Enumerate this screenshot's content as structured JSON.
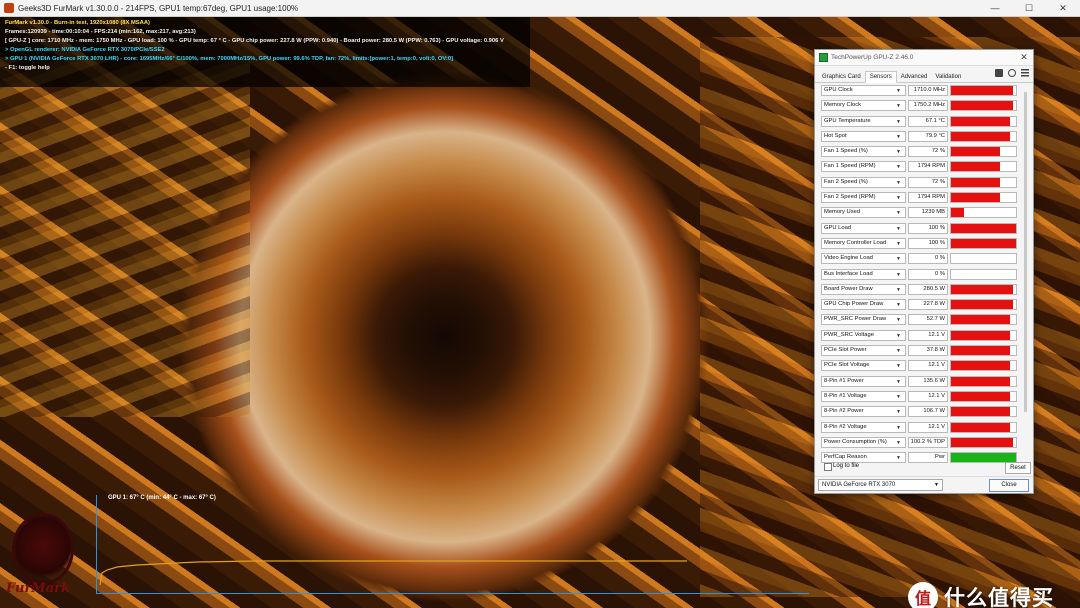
{
  "window": {
    "title": "Geeks3D FurMark v1.30.0.0 - 214FPS, GPU1 temp:67deg, GPU1 usage:100%",
    "minimize": "—",
    "maximize": "☐",
    "close": "✕"
  },
  "overlay": {
    "lines": [
      "FurMark v1.30.0 - Burn-in test, 1920x1080 (8X MSAA)",
      "Frames:120939 - time:00:10:04 - FPS:214 (min:162, max:217, avg:213)",
      "[ GPU-Z ] core: 1710 MHz - mem: 1750 MHz - GPU load: 100 % - GPU temp: 67 ° C - GPU chip power: 227.8 W (PPW: 0.940) - Board power: 280.5 W (PPW: 0.763) - GPU voltage: 0.906 V",
      "> OpenGL renderer: NVIDIA GeForce RTX 3070/PCIe/SSE2",
      "> GPU 1 (NVIDIA GeForce RTX 3070 LHR) - core: 1695MHz/66° C/100%, mem: 7000MHz/15%, GPU power: 99.6% TDP, fan: 72%, limits:[power:1, temp:0, volt:0, OV:0]",
      "- F1: toggle help"
    ]
  },
  "temp_graph": {
    "label": "GPU 1: 67° C (min: 44° C - max: 67° C)",
    "min": 44,
    "max": 67
  },
  "logo": {
    "text": "FurMark"
  },
  "watermark": {
    "badge": "值",
    "text": "什么值得买"
  },
  "gpuz": {
    "title": "TechPowerUp GPU-Z 2.46.0",
    "close": "✕",
    "tabs": [
      "Graphics Card",
      "Sensors",
      "Advanced",
      "Validation"
    ],
    "active_tab": "Sensors",
    "sensors": [
      {
        "name": "GPU Clock",
        "value": "1710.0 MHz",
        "level": 0.95,
        "color": "#e51010"
      },
      {
        "name": "Memory Clock",
        "value": "1750.2 MHz",
        "level": 0.95,
        "color": "#e51010"
      },
      {
        "name": "GPU Temperature",
        "value": "67.1 °C",
        "level": 0.9,
        "color": "#e51010"
      },
      {
        "name": "Hot Spot",
        "value": "79.9 °C",
        "level": 0.9,
        "color": "#e51010"
      },
      {
        "name": "Fan 1 Speed (%)",
        "value": "72 %",
        "level": 0.75,
        "color": "#e51010"
      },
      {
        "name": "Fan 1 Speed (RPM)",
        "value": "1794 RPM",
        "level": 0.75,
        "color": "#e51010"
      },
      {
        "name": "Fan 2 Speed (%)",
        "value": "72 %",
        "level": 0.75,
        "color": "#e51010"
      },
      {
        "name": "Fan 2 Speed (RPM)",
        "value": "1794 RPM",
        "level": 0.75,
        "color": "#e51010"
      },
      {
        "name": "Memory Used",
        "value": "1239 MB",
        "level": 0.2,
        "color": "#e51010"
      },
      {
        "name": "GPU Load",
        "value": "100 %",
        "level": 1.0,
        "color": "#e51010"
      },
      {
        "name": "Memory Controller Load",
        "value": "100 %",
        "level": 1.0,
        "color": "#e51010"
      },
      {
        "name": "Video Engine Load",
        "value": "0 %",
        "level": 0,
        "color": "#e51010"
      },
      {
        "name": "Bus Interface Load",
        "value": "0 %",
        "level": 0,
        "color": "#e51010"
      },
      {
        "name": "Board Power Draw",
        "value": "280.5 W",
        "level": 0.95,
        "color": "#e51010"
      },
      {
        "name": "GPU Chip Power Draw",
        "value": "227.8 W",
        "level": 0.95,
        "color": "#e51010"
      },
      {
        "name": "PWR_SRC Power Draw",
        "value": "52.7 W",
        "level": 0.9,
        "color": "#e51010"
      },
      {
        "name": "PWR_SRC Voltage",
        "value": "12.1 V",
        "level": 0.9,
        "color": "#e51010"
      },
      {
        "name": "PCIe Slot Power",
        "value": "37.8 W",
        "level": 0.9,
        "color": "#e51010"
      },
      {
        "name": "PCIe Slot Voltage",
        "value": "12.1 V",
        "level": 0.9,
        "color": "#e51010"
      },
      {
        "name": "8-Pin #1 Power",
        "value": "135.6 W",
        "level": 0.9,
        "color": "#e51010"
      },
      {
        "name": "8-Pin #1 Voltage",
        "value": "12.1 V",
        "level": 0.9,
        "color": "#e51010"
      },
      {
        "name": "8-Pin #2 Power",
        "value": "106.7 W",
        "level": 0.9,
        "color": "#e51010"
      },
      {
        "name": "8-Pin #2 Voltage",
        "value": "12.1 V",
        "level": 0.9,
        "color": "#e51010"
      },
      {
        "name": "Power Consumption (%)",
        "value": "100.2 % TDP",
        "level": 0.95,
        "color": "#e51010"
      },
      {
        "name": "PerfCap Reason",
        "value": "Pwr",
        "level": 1.0,
        "color": "#17b417"
      }
    ],
    "log_label": "Log to file",
    "reset_label": "Reset",
    "gpu_select": "NVIDIA GeForce RTX 3070",
    "close_label": "Close"
  }
}
